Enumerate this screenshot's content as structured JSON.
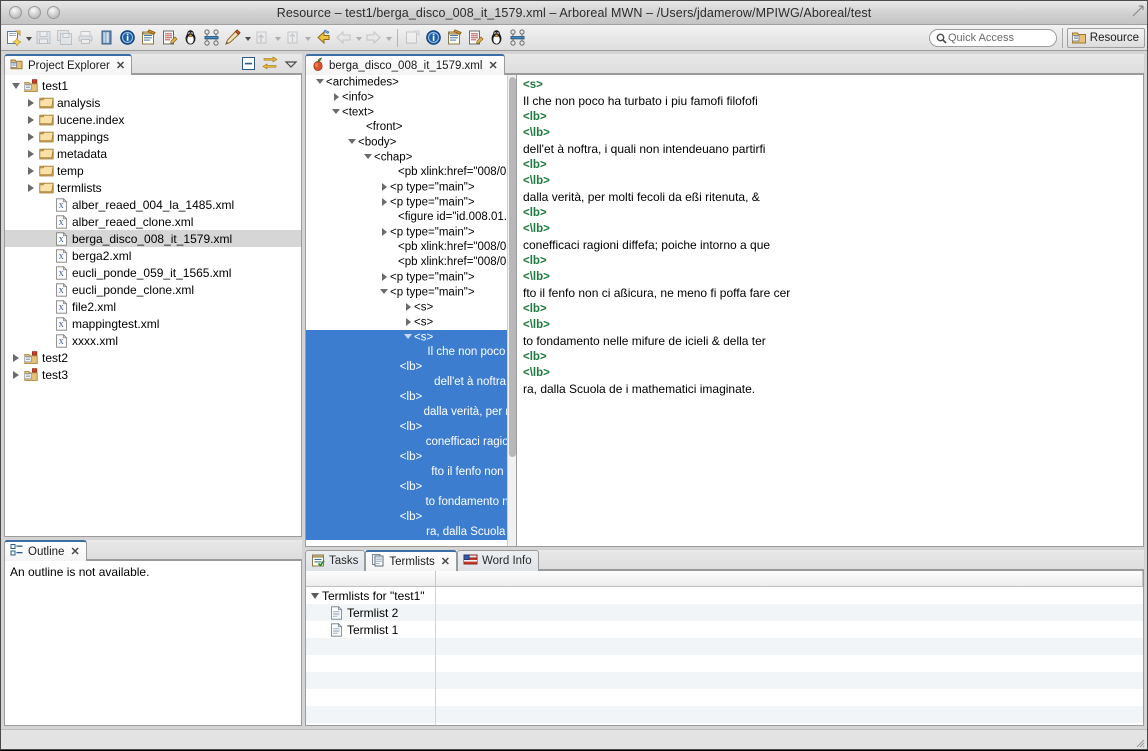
{
  "window": {
    "title": "Resource – test1/berga_disco_008_it_1579.xml – Arboreal MWN – /Users/jdamerow/MPIWG/Aboreal/test",
    "traffic_icons": [
      "close-button",
      "minimize-button",
      "zoom-button"
    ]
  },
  "toolbar": {
    "icons": [
      "new-wizard-icon",
      "save-icon",
      "save-all-icon",
      "print-icon",
      "new-project-icon",
      "info-icon",
      "notes-icon",
      "edit-document-icon",
      "penguin-icon",
      "hierarchy-icon",
      "annotate-icon",
      "import-icon",
      "toggle-mark-icon",
      "back-icon",
      "forward-icon",
      "new-editor-icon",
      "info2-icon",
      "notes2-icon",
      "edit-document2-icon",
      "penguin2-icon",
      "hierarchy2-icon"
    ],
    "quick_access": {
      "placeholder": "Quick Access",
      "value": "",
      "icon": "search-icon"
    },
    "new_perspective_icon": "open-perspective-icon",
    "perspective_label": "Resource",
    "perspective_icon": "resource-perspective-icon"
  },
  "project_explorer": {
    "tab_label": "Project Explorer",
    "tab_icon": "project-explorer-icon",
    "tab_close": "✕",
    "tools": [
      "collapse-all-icon",
      "link-with-editor-icon",
      "view-menu-icon"
    ],
    "tree": [
      {
        "label": "test1",
        "icon": "project-icon",
        "depth": 0,
        "state": "open",
        "selected": false
      },
      {
        "label": "analysis",
        "icon": "folder-icon",
        "depth": 1,
        "state": "closed",
        "selected": false
      },
      {
        "label": "lucene.index",
        "icon": "folder-icon",
        "depth": 1,
        "state": "closed",
        "selected": false
      },
      {
        "label": "mappings",
        "icon": "folder-icon",
        "depth": 1,
        "state": "closed",
        "selected": false
      },
      {
        "label": "metadata",
        "icon": "folder-icon",
        "depth": 1,
        "state": "closed",
        "selected": false
      },
      {
        "label": "temp",
        "icon": "folder-icon",
        "depth": 1,
        "state": "closed",
        "selected": false
      },
      {
        "label": "termlists",
        "icon": "folder-icon",
        "depth": 1,
        "state": "closed",
        "selected": false
      },
      {
        "label": "alber_reaed_004_la_1485.xml",
        "icon": "xml-file-icon",
        "depth": 2,
        "state": "none",
        "selected": false
      },
      {
        "label": "alber_reaed_clone.xml",
        "icon": "xml-file-icon",
        "depth": 2,
        "state": "none",
        "selected": false
      },
      {
        "label": "berga_disco_008_it_1579.xml",
        "icon": "xml-file-icon",
        "depth": 2,
        "state": "none",
        "selected": true
      },
      {
        "label": "berga2.xml",
        "icon": "xml-file-icon",
        "depth": 2,
        "state": "none",
        "selected": false
      },
      {
        "label": "eucli_ponde_059_it_1565.xml",
        "icon": "xml-file-icon",
        "depth": 2,
        "state": "none",
        "selected": false
      },
      {
        "label": "eucli_ponde_clone.xml",
        "icon": "xml-file-icon",
        "depth": 2,
        "state": "none",
        "selected": false
      },
      {
        "label": "file2.xml",
        "icon": "xml-file-icon",
        "depth": 2,
        "state": "none",
        "selected": false
      },
      {
        "label": "mappingtest.xml",
        "icon": "xml-file-icon",
        "depth": 2,
        "state": "none",
        "selected": false
      },
      {
        "label": "xxxx.xml",
        "icon": "xml-file-icon",
        "depth": 2,
        "state": "none",
        "selected": false
      },
      {
        "label": "test2",
        "icon": "project-icon",
        "depth": 0,
        "state": "closed",
        "selected": false
      },
      {
        "label": "test3",
        "icon": "project-icon",
        "depth": 0,
        "state": "closed",
        "selected": false
      }
    ]
  },
  "outline": {
    "tab_label": "Outline",
    "tab_icon": "outline-icon",
    "tab_close": "✕",
    "message": "An outline is not available."
  },
  "editor": {
    "tab_label": "berga_disco_008_it_1579.xml",
    "tab_icon": "arboreal-file-icon",
    "tab_close": "✕",
    "xml_tree": [
      {
        "label": "<archimedes>",
        "indent": 1,
        "state": "open",
        "align": "left",
        "selected": false
      },
      {
        "label": "<info>",
        "indent": 3,
        "state": "closed",
        "align": "left",
        "selected": false
      },
      {
        "label": "<text>",
        "indent": 3,
        "state": "open",
        "align": "left",
        "selected": false
      },
      {
        "label": "<front>",
        "indent": 6,
        "state": "none",
        "align": "left",
        "selected": false
      },
      {
        "label": "<body>",
        "indent": 5,
        "state": "open",
        "align": "left",
        "selected": false
      },
      {
        "label": "<chap>",
        "indent": 7,
        "state": "open",
        "align": "left",
        "selected": false
      },
      {
        "label": "<pb xlink:href=\"008/0",
        "indent": 10,
        "state": "none",
        "align": "left",
        "selected": false
      },
      {
        "label": "<p type=\"main\">",
        "indent": 9,
        "state": "closed",
        "align": "left",
        "selected": false
      },
      {
        "label": "<p type=\"main\">",
        "indent": 9,
        "state": "closed",
        "align": "left",
        "selected": false
      },
      {
        "label": "<figure id=\"id.008.01.0",
        "indent": 10,
        "state": "none",
        "align": "left",
        "selected": false
      },
      {
        "label": "<p type=\"main\">",
        "indent": 9,
        "state": "closed",
        "align": "left",
        "selected": false
      },
      {
        "label": "<pb xlink:href=\"008/0",
        "indent": 10,
        "state": "none",
        "align": "left",
        "selected": false
      },
      {
        "label": "<pb xlink:href=\"008/0",
        "indent": 10,
        "state": "none",
        "align": "left",
        "selected": false
      },
      {
        "label": "<p type=\"main\">",
        "indent": 9,
        "state": "closed",
        "align": "left",
        "selected": false
      },
      {
        "label": "<p type=\"main\">",
        "indent": 9,
        "state": "open",
        "align": "left",
        "selected": false
      },
      {
        "label": "<s>",
        "indent": 12,
        "state": "closed",
        "align": "left",
        "selected": false
      },
      {
        "label": "<s>",
        "indent": 12,
        "state": "closed",
        "align": "left",
        "selected": false
      },
      {
        "label": "<s>",
        "indent": 12,
        "state": "open",
        "align": "left",
        "selected": true
      },
      {
        "label": "Il che non poco h",
        "indent": 0,
        "state": "none",
        "align": "right",
        "selected": true
      },
      {
        "label": "<lb>",
        "indent": 0,
        "state": "none",
        "align": "center",
        "selected": true
      },
      {
        "label": "dell'et à noftra, i ",
        "indent": 0,
        "state": "none",
        "align": "right",
        "selected": true
      },
      {
        "label": "<lb>",
        "indent": 0,
        "state": "none",
        "align": "center",
        "selected": true
      },
      {
        "label": "dalla verità, per m",
        "indent": 0,
        "state": "none",
        "align": "right",
        "selected": true
      },
      {
        "label": "<lb>",
        "indent": 0,
        "state": "none",
        "align": "center",
        "selected": true
      },
      {
        "label": "conefficaci ragion",
        "indent": 0,
        "state": "none",
        "align": "right",
        "selected": true
      },
      {
        "label": "<lb>",
        "indent": 0,
        "state": "none",
        "align": "center",
        "selected": true
      },
      {
        "label": "fto il fenfo non ci",
        "indent": 0,
        "state": "none",
        "align": "right",
        "selected": true
      },
      {
        "label": "<lb>",
        "indent": 0,
        "state": "none",
        "align": "center",
        "selected": true
      },
      {
        "label": "to fondamento ne",
        "indent": 0,
        "state": "none",
        "align": "right",
        "selected": true
      },
      {
        "label": "<lb>",
        "indent": 0,
        "state": "none",
        "align": "center",
        "selected": true
      },
      {
        "label": "ra, dalla Scuola d",
        "indent": 0,
        "state": "none",
        "align": "right",
        "selected": true
      }
    ],
    "text_lines": [
      {
        "text": "<s>",
        "kind": "tag"
      },
      {
        "text": "Il che non poco ha turbato i piu famofi filofofi",
        "kind": "text"
      },
      {
        "text": "<lb>",
        "kind": "tag"
      },
      {
        "text": "<\\lb>",
        "kind": "tag"
      },
      {
        "text": "dell'et à noftra, i quali non intendeuano partirfi",
        "kind": "text"
      },
      {
        "text": "<lb>",
        "kind": "tag"
      },
      {
        "text": "<\\lb>",
        "kind": "tag"
      },
      {
        "text": "dalla verità, per molti fecoli da eßi ritenuta, &",
        "kind": "text"
      },
      {
        "text": "<lb>",
        "kind": "tag"
      },
      {
        "text": "<\\lb>",
        "kind": "tag"
      },
      {
        "text": "conefficaci ragioni diffefa; poiche intorno a que",
        "kind": "text"
      },
      {
        "text": "<lb>",
        "kind": "tag"
      },
      {
        "text": "<\\lb>",
        "kind": "tag"
      },
      {
        "text": "fto il fenfo non ci aßicura, ne meno fi poffa fare cer",
        "kind": "text"
      },
      {
        "text": "<lb>",
        "kind": "tag"
      },
      {
        "text": "<\\lb>",
        "kind": "tag"
      },
      {
        "text": "to fondamento nelle mifure de icieli & della ter",
        "kind": "tag-free"
      },
      {
        "text": "<lb>",
        "kind": "tag"
      },
      {
        "text": "<\\lb>",
        "kind": "tag"
      },
      {
        "text": "ra, dalla Scuola de i mathematici imaginate.",
        "kind": "text"
      }
    ]
  },
  "bottom_panel": {
    "tabs": [
      {
        "label": "Tasks",
        "icon": "tasks-icon",
        "active": false,
        "close": ""
      },
      {
        "label": "Termlists",
        "icon": "termlists-icon",
        "active": true,
        "close": "✕"
      },
      {
        "label": "Word Info",
        "icon": "word-info-icon",
        "active": false,
        "close": ""
      }
    ],
    "columns": [
      "",
      ""
    ],
    "rows": [
      {
        "label": "Termlists for \"test1\"",
        "icon": "",
        "depth": 0,
        "expanded": true
      },
      {
        "label": "Termlist 2",
        "icon": "termlist-file-icon",
        "depth": 1,
        "expanded": false
      },
      {
        "label": "Termlist 1",
        "icon": "termlist-file-icon",
        "depth": 1,
        "expanded": false
      }
    ],
    "empty_row_count": 6
  },
  "colors": {
    "selection_blue": "#3d7dd0",
    "tag_green": "#1f7a3f",
    "file_selection_grey": "#d6d6d6",
    "tab_active_top": "#3a6ea5"
  }
}
